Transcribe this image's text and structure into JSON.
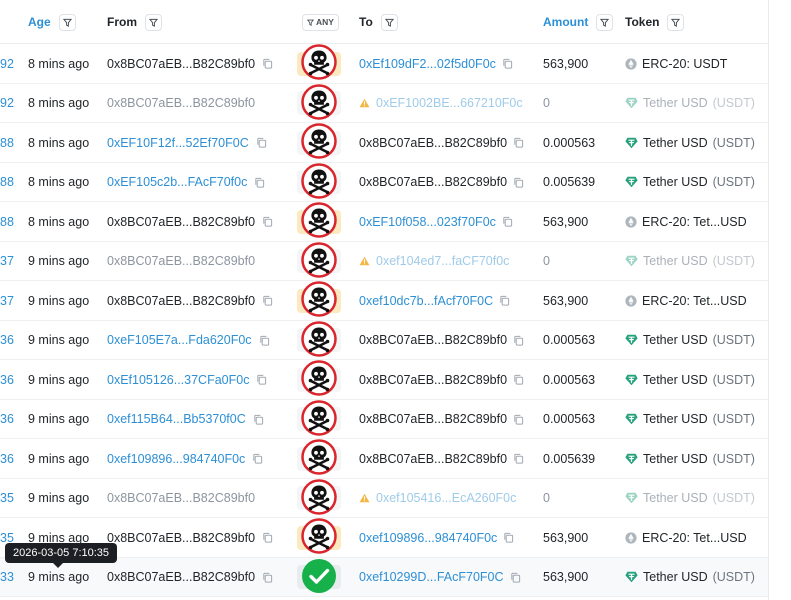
{
  "headers": {
    "age": "Age",
    "from": "From",
    "any": "ANY",
    "to": "To",
    "amount": "Amount",
    "token": "Token"
  },
  "tooltip": "2026-03-05 7:10:35",
  "rows": [
    {
      "tx": "92",
      "age": "8 mins ago",
      "from": "0x8BC07aEB...B82C89bf0",
      "from_style": "plain",
      "from_copy": true,
      "badge": "skull",
      "badge_bg": "yellow",
      "to": "0xEf109dF2...02f5d0F0c",
      "to_style": "link",
      "to_copy": true,
      "amount": "563,900",
      "amount_style": "plain",
      "token": "ERC-20: USDT",
      "token_paren": "",
      "token_icon": "gray"
    },
    {
      "tx": "92",
      "age": "8 mins ago",
      "from": "0x8BC07aEB...B82C89bf0",
      "from_style": "dim",
      "from_copy": false,
      "badge": "skull",
      "badge_bg": "plain",
      "to": "0xEF1002BE...667210F0c",
      "to_style": "warn",
      "to_copy": false,
      "amount": "0",
      "amount_style": "dim",
      "token": "Tether USD",
      "token_paren": "(USDT)",
      "token_icon": "green-dim"
    },
    {
      "tx": "88",
      "age": "8 mins ago",
      "from": "0xEF10F12f...52Ef70F0C",
      "from_style": "link",
      "from_copy": true,
      "badge": "skull",
      "badge_bg": "plain",
      "to": "0x8BC07aEB...B82C89bf0",
      "to_style": "plain",
      "to_copy": true,
      "amount": "0.000563",
      "amount_style": "plain",
      "token": "Tether USD",
      "token_paren": "(USDT)",
      "token_icon": "green"
    },
    {
      "tx": "88",
      "age": "8 mins ago",
      "from": "0xEF105c2b...FAcF70f0c",
      "from_style": "link",
      "from_copy": true,
      "badge": "skull",
      "badge_bg": "plain",
      "to": "0x8BC07aEB...B82C89bf0",
      "to_style": "plain",
      "to_copy": true,
      "amount": "0.005639",
      "amount_style": "plain",
      "token": "Tether USD",
      "token_paren": "(USDT)",
      "token_icon": "green"
    },
    {
      "tx": "88",
      "age": "8 mins ago",
      "from": "0x8BC07aEB...B82C89bf0",
      "from_style": "plain",
      "from_copy": true,
      "badge": "skull",
      "badge_bg": "yellow",
      "to": "0xEF10f058...023f70F0c",
      "to_style": "link",
      "to_copy": true,
      "amount": "563,900",
      "amount_style": "plain",
      "token": "ERC-20: Tet...USD",
      "token_paren": "",
      "token_icon": "gray"
    },
    {
      "tx": "37",
      "age": "9 mins ago",
      "from": "0x8BC07aEB...B82C89bf0",
      "from_style": "dim",
      "from_copy": false,
      "badge": "skull",
      "badge_bg": "plain",
      "to": "0xef104ed7...faCF70f0c",
      "to_style": "warn",
      "to_copy": false,
      "amount": "0",
      "amount_style": "dim",
      "token": "Tether USD",
      "token_paren": "(USDT)",
      "token_icon": "green-dim"
    },
    {
      "tx": "37",
      "age": "9 mins ago",
      "from": "0x8BC07aEB...B82C89bf0",
      "from_style": "plain",
      "from_copy": true,
      "badge": "skull",
      "badge_bg": "yellow",
      "to": "0xef10dc7b...fAcf70F0C",
      "to_style": "link",
      "to_copy": true,
      "amount": "563,900",
      "amount_style": "plain",
      "token": "ERC-20: Tet...USD",
      "token_paren": "",
      "token_icon": "gray"
    },
    {
      "tx": "36",
      "age": "9 mins ago",
      "from": "0xeF105E7a...Fda620F0c",
      "from_style": "link",
      "from_copy": true,
      "badge": "skull",
      "badge_bg": "plain",
      "to": "0x8BC07aEB...B82C89bf0",
      "to_style": "plain",
      "to_copy": true,
      "amount": "0.000563",
      "amount_style": "plain",
      "token": "Tether USD",
      "token_paren": "(USDT)",
      "token_icon": "green"
    },
    {
      "tx": "36",
      "age": "9 mins ago",
      "from": "0xEf105126...37CFa0F0c",
      "from_style": "link",
      "from_copy": true,
      "badge": "skull",
      "badge_bg": "plain",
      "to": "0x8BC07aEB...B82C89bf0",
      "to_style": "plain",
      "to_copy": true,
      "amount": "0.000563",
      "amount_style": "plain",
      "token": "Tether USD",
      "token_paren": "(USDT)",
      "token_icon": "green"
    },
    {
      "tx": "36",
      "age": "9 mins ago",
      "from": "0xef115B64...Bb5370f0C",
      "from_style": "link",
      "from_copy": true,
      "badge": "skull",
      "badge_bg": "plain",
      "to": "0x8BC07aEB...B82C89bf0",
      "to_style": "plain",
      "to_copy": true,
      "amount": "0.000563",
      "amount_style": "plain",
      "token": "Tether USD",
      "token_paren": "(USDT)",
      "token_icon": "green"
    },
    {
      "tx": "36",
      "age": "9 mins ago",
      "from": "0xef109896...984740F0c",
      "from_style": "link",
      "from_copy": true,
      "badge": "skull",
      "badge_bg": "plain",
      "to": "0x8BC07aEB...B82C89bf0",
      "to_style": "plain",
      "to_copy": true,
      "amount": "0.005639",
      "amount_style": "plain",
      "token": "Tether USD",
      "token_paren": "(USDT)",
      "token_icon": "green"
    },
    {
      "tx": "35",
      "age": "9 mins ago",
      "from": "0x8BC07aEB...B82C89bf0",
      "from_style": "dim",
      "from_copy": false,
      "badge": "skull",
      "badge_bg": "plain",
      "to": "0xef105416...EcA260F0c",
      "to_style": "warn",
      "to_copy": false,
      "amount": "0",
      "amount_style": "dim",
      "token": "Tether USD",
      "token_paren": "(USDT)",
      "token_icon": "green-dim"
    },
    {
      "tx": "35",
      "age": "9 mins ago",
      "from": "0x8BC07aEB...B82C89bf0",
      "from_style": "plain",
      "from_copy": true,
      "badge": "skull",
      "badge_bg": "yellow",
      "to": "0xef109896...984740F0c",
      "to_style": "link",
      "to_copy": true,
      "amount": "563,900",
      "amount_style": "plain",
      "token": "ERC-20: Tet...USD",
      "token_paren": "",
      "token_icon": "gray"
    },
    {
      "tx": "33",
      "age": "9 mins ago",
      "from": "0x8BC07aEB...B82C89bf0",
      "from_style": "plain",
      "from_copy": true,
      "badge": "check",
      "badge_bg": "muted",
      "to": "0xef10299D...FAcF70F0C",
      "to_style": "link",
      "to_copy": true,
      "amount": "563,900",
      "amount_style": "plain",
      "token": "Tether USD",
      "token_paren": "(USDT)",
      "token_icon": "green"
    }
  ],
  "colors": {
    "link": "#2d8fd5",
    "danger": "#d9252b",
    "success": "#16b14a",
    "tether": "#26a17b",
    "warning": "#f3b741"
  }
}
